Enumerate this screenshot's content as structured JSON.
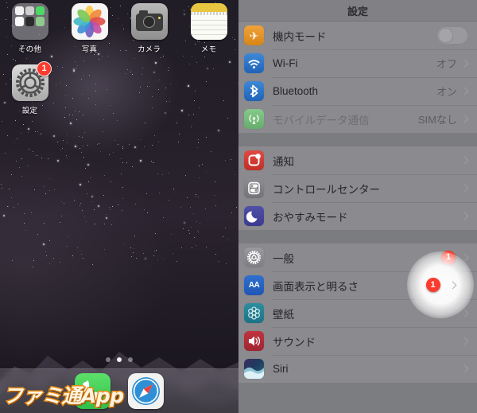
{
  "home_screen": {
    "apps": [
      {
        "name": "その他",
        "icon": "folder-icon"
      },
      {
        "name": "写真",
        "icon": "photos-icon"
      },
      {
        "name": "カメラ",
        "icon": "camera-icon"
      },
      {
        "name": "メモ",
        "icon": "notes-icon"
      },
      {
        "name": "設定",
        "icon": "settings-gear-icon",
        "badge": "1"
      }
    ],
    "dock": [
      {
        "name": "電話",
        "icon": "phone-icon"
      },
      {
        "name": "Safari",
        "icon": "safari-compass-icon"
      }
    ],
    "page_dots": {
      "count": 3,
      "active_index": 1
    },
    "watermark": "ファミ通App"
  },
  "settings": {
    "title": "設定",
    "groups": [
      {
        "rows": [
          {
            "label": "機内モード",
            "icon": "airplane-icon",
            "control": "toggle",
            "toggle_on": false
          },
          {
            "label": "Wi-Fi",
            "icon": "wifi-icon",
            "value": "オフ",
            "control": "chevron"
          },
          {
            "label": "Bluetooth",
            "icon": "bluetooth-icon",
            "value": "オン",
            "control": "chevron"
          },
          {
            "label": "モバイルデータ通信",
            "icon": "cellular-icon",
            "value": "SIMなし",
            "control": "chevron",
            "disabled": true
          }
        ]
      },
      {
        "rows": [
          {
            "label": "通知",
            "icon": "notifications-icon",
            "control": "chevron"
          },
          {
            "label": "コントロールセンター",
            "icon": "control-center-icon",
            "control": "chevron"
          },
          {
            "label": "おやすみモード",
            "icon": "do-not-disturb-moon-icon",
            "control": "chevron"
          }
        ]
      },
      {
        "rows": [
          {
            "label": "一般",
            "icon": "general-gear-icon",
            "badge": "1",
            "control": "chevron",
            "highlighted": true
          },
          {
            "label": "画面表示と明るさ",
            "icon": "display-brightness-icon",
            "control": "chevron"
          },
          {
            "label": "壁紙",
            "icon": "wallpaper-icon",
            "control": "chevron"
          },
          {
            "label": "サウンド",
            "icon": "sound-speaker-icon",
            "control": "chevron"
          },
          {
            "label": "Siri",
            "icon": "siri-icon",
            "control": "chevron"
          }
        ]
      }
    ],
    "highlight": {
      "badge": "1",
      "target_row": "一般"
    }
  },
  "colors": {
    "badge_red": "#fc3b2d",
    "panel_bg": "#7c7d81",
    "row_bg": "#8b8b8f",
    "accent_orange": "#e98c12"
  }
}
